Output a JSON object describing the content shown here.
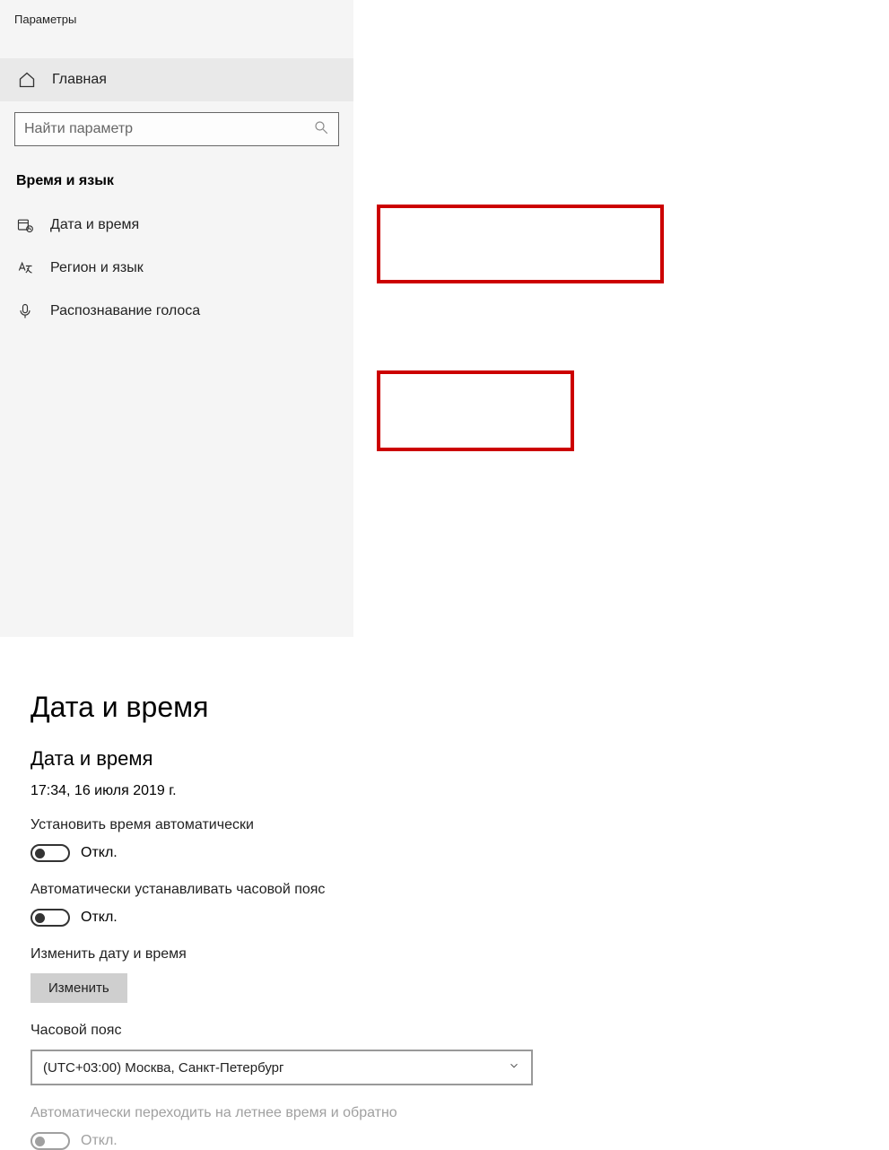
{
  "app": {
    "title": "Параметры"
  },
  "sidebar": {
    "home": "Главная",
    "search_placeholder": "Найти параметр",
    "category": "Время и язык",
    "items": [
      {
        "label": "Дата и время"
      },
      {
        "label": "Регион и язык"
      },
      {
        "label": "Распознавание голоса"
      }
    ]
  },
  "main": {
    "title": "Дата и время",
    "section_title": "Дата и время",
    "current_datetime": "17:34, 16 июля 2019 г.",
    "auto_time": {
      "label": "Установить время автоматически",
      "state": "Откл."
    },
    "auto_tz": {
      "label": "Автоматически устанавливать часовой пояс",
      "state": "Откл."
    },
    "change": {
      "label": "Изменить дату и время",
      "button": "Изменить"
    },
    "tz": {
      "label": "Часовой пояс",
      "value": "(UTC+03:00) Москва, Санкт-Петербург"
    },
    "dst": {
      "label": "Автоматически переходить на летнее время и обратно",
      "state": "Откл."
    }
  }
}
